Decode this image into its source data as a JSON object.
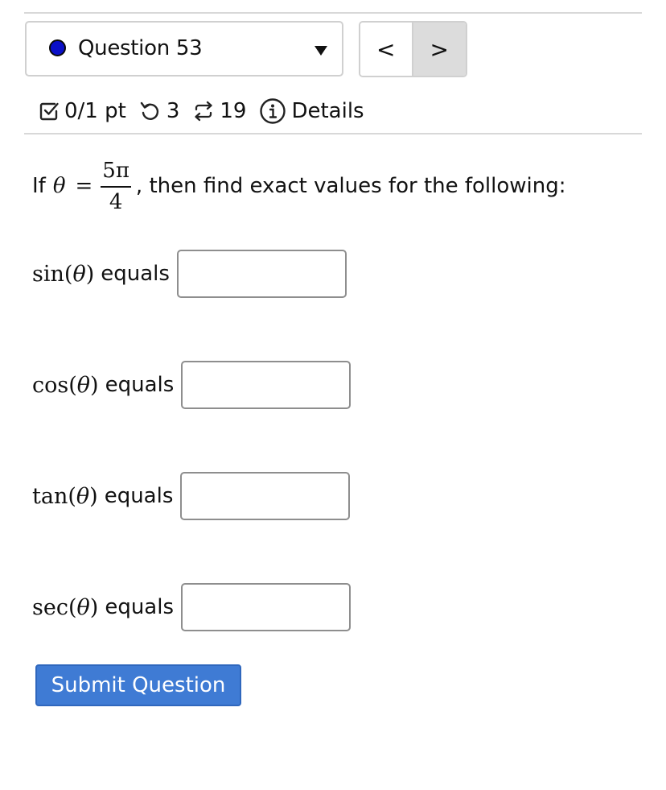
{
  "question_select": {
    "label": "Question 53",
    "status_color": "#0b10c8"
  },
  "nav": {
    "prev_label": "<",
    "next_label": ">"
  },
  "meta": {
    "score": "0/1 pt",
    "retries": "3",
    "attempts": "19",
    "details_label": "Details"
  },
  "prompt": {
    "prefix": "If",
    "theta": "θ",
    "equals": "=",
    "numerator": "5π",
    "denominator": "4",
    "suffix": ", then find exact values for the following:"
  },
  "rows": [
    {
      "fn": "sin",
      "arg": "θ",
      "label": "equals",
      "value": ""
    },
    {
      "fn": "cos",
      "arg": "θ",
      "label": "equals",
      "value": ""
    },
    {
      "fn": "tan",
      "arg": "θ",
      "label": "equals",
      "value": ""
    },
    {
      "fn": "sec",
      "arg": "θ",
      "label": "equals",
      "value": ""
    }
  ],
  "submit_label": "Submit Question",
  "colors": {
    "submit_bg": "#3f7bd4",
    "next_bg": "#dcdcdc"
  }
}
